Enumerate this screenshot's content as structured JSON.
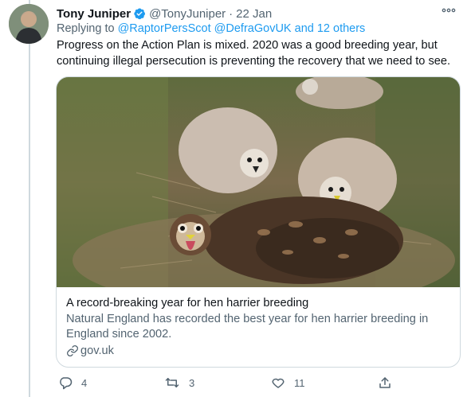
{
  "tweet": {
    "author_name": "Tony Juniper",
    "author_handle": "@TonyJuniper",
    "separator": "·",
    "date": "22 Jan",
    "replying_to_prefix": "Replying to",
    "replying_to_users": "@RaptorPersScot @DefraGovUK",
    "replying_to_others": "and 12 others",
    "text": "Progress on the Action Plan is mixed. 2020 was a good breeding year, but continuing illegal persecution is preventing the recovery that we need to see."
  },
  "card": {
    "title": "A record-breaking year for hen harrier breeding",
    "description": "Natural England has recorded the best year for hen harrier breeding in England since 2002.",
    "domain": "gov.uk"
  },
  "actions": {
    "replies": "4",
    "retweets": "3",
    "likes": "11"
  },
  "colors": {
    "accent": "#1d9bf0",
    "secondary_text": "#536471",
    "border": "#cfd9de"
  },
  "icons": [
    "verified-badge-icon",
    "more-options-icon",
    "link-icon",
    "reply-icon",
    "retweet-icon",
    "like-icon",
    "share-icon"
  ]
}
